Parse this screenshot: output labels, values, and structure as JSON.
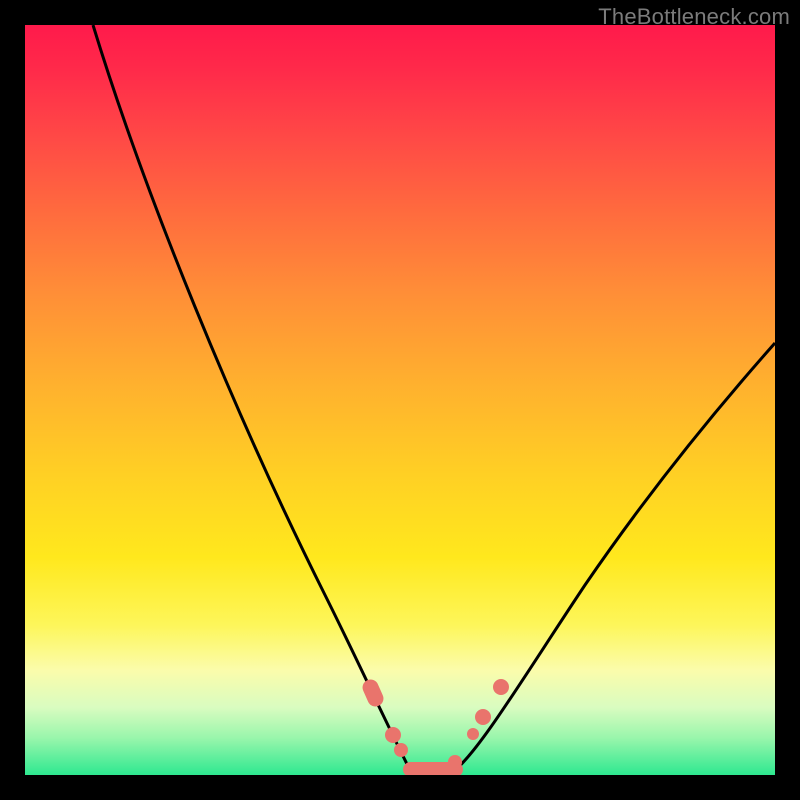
{
  "watermark": "TheBottleneck.com",
  "chart_data": {
    "type": "line",
    "title": "",
    "xlabel": "",
    "ylabel": "",
    "xlim": [
      0,
      100
    ],
    "ylim": [
      0,
      100
    ],
    "grid": false,
    "series": [
      {
        "name": "left-branch",
        "x": [
          9,
          14,
          20,
          26,
          32,
          38,
          42,
          46,
          49,
          51
        ],
        "y": [
          100,
          86,
          70,
          55,
          40,
          26,
          17,
          9,
          3,
          0
        ]
      },
      {
        "name": "right-branch",
        "x": [
          56,
          59,
          62,
          66,
          72,
          80,
          90,
          100
        ],
        "y": [
          0,
          3,
          7,
          13,
          22,
          33,
          46,
          58
        ]
      }
    ],
    "bottom_segment": {
      "x_start": 49,
      "x_end": 58,
      "y": 0
    },
    "markers": [
      {
        "x": 46.5,
        "y": 11,
        "kind": "pill",
        "angle": 68
      },
      {
        "x": 49.1,
        "y": 5.4,
        "kind": "dot"
      },
      {
        "x": 50.2,
        "y": 3.2,
        "kind": "dot"
      },
      {
        "x": 53.5,
        "y": 0.5,
        "kind": "bar"
      },
      {
        "x": 57.4,
        "y": 1.8,
        "kind": "dot"
      },
      {
        "x": 59.8,
        "y": 5.5,
        "kind": "dot-small"
      },
      {
        "x": 61.1,
        "y": 7.8,
        "kind": "dot"
      },
      {
        "x": 63.4,
        "y": 11.8,
        "kind": "dot"
      }
    ],
    "gradient_stops": [
      {
        "pos": 0,
        "color": "#ff1a4b"
      },
      {
        "pos": 50,
        "color": "#ffb52d"
      },
      {
        "pos": 80,
        "color": "#fdf65a"
      },
      {
        "pos": 100,
        "color": "#2ee890"
      }
    ]
  }
}
